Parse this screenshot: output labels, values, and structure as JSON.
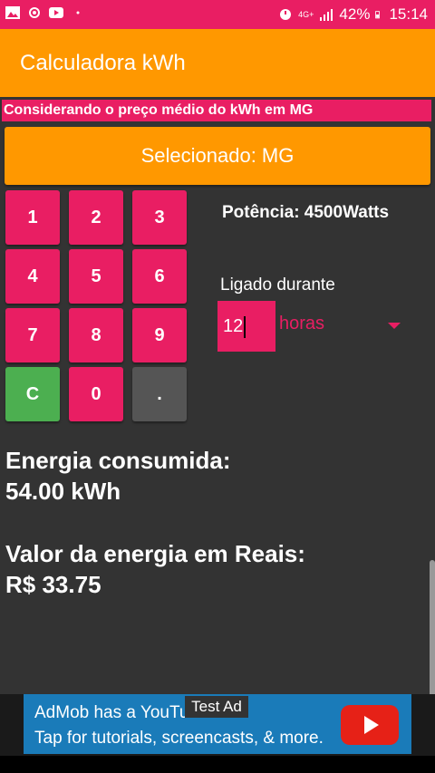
{
  "status_bar": {
    "left_icons": [
      "image-icon",
      "cast-icon",
      "youtube-icon",
      "dot-icon"
    ],
    "right_icons": [
      "alarm-icon",
      "wifi-icon",
      "signal-icon",
      "battery-icon"
    ],
    "network_label": "4G+",
    "battery": "42%",
    "time": "15:14"
  },
  "app_bar": {
    "title": "Calculadora kWh"
  },
  "info_bar": {
    "text": "Considerando o preço médio do kWh em MG"
  },
  "state_selector": {
    "label": "Selecionado: MG"
  },
  "keypad": {
    "keys": [
      "1",
      "2",
      "3",
      "4",
      "5",
      "6",
      "7",
      "8",
      "9",
      "C",
      "0",
      "."
    ]
  },
  "power": {
    "label": "Potência: 4500Watts"
  },
  "duration": {
    "label": "Ligado durante",
    "value": "12",
    "unit": "horas"
  },
  "results": {
    "energy_label": "Energia consumida:",
    "energy_value": "54.00 kWh",
    "cost_label": "Valor da energia em Reais:",
    "cost_value": "R$ 33.75"
  },
  "ad": {
    "line1": "AdMob has a YouTube Ads!",
    "line2": "Tap for tutorials, screencasts, & more.",
    "test_label": "Test Ad"
  },
  "colors": {
    "primary": "#FF9800",
    "accent": "#E91E63",
    "background": "#333333",
    "clear_key": "#4CAF50"
  }
}
